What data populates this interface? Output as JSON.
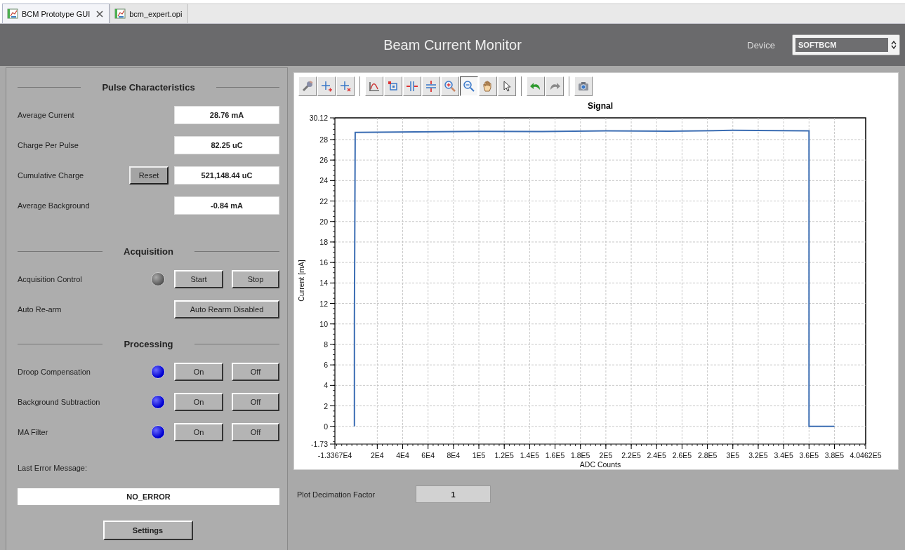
{
  "tabs": [
    {
      "label": "BCM Prototype GUI",
      "selected": true,
      "closable": true
    },
    {
      "label": "bcm_expert.opi",
      "selected": false,
      "closable": false
    }
  ],
  "header": {
    "title": "Beam Current Monitor",
    "device_label": "Device",
    "device": "SOFTBCM"
  },
  "sections": [
    {
      "title": "Pulse Characteristics",
      "rows": [
        {
          "kind": "readout",
          "label": "Average Current",
          "value": "28.76 mA"
        },
        {
          "kind": "readout",
          "label": "Charge Per Pulse",
          "value": "82.25 uC"
        },
        {
          "kind": "readout",
          "label": "Cumulative Charge",
          "button": "Reset",
          "value": "521,148.44 uC"
        },
        {
          "kind": "readout",
          "label": "Average Background",
          "value": "-0.84 mA"
        }
      ]
    },
    {
      "title": "Acquisition",
      "rows": [
        {
          "kind": "led-buttons",
          "label": "Acquisition Control",
          "on": false,
          "buttons": [
            "Start",
            "Stop"
          ]
        },
        {
          "kind": "button",
          "label": "Auto Re-arm",
          "button": "Auto Rearm Disabled"
        }
      ]
    },
    {
      "title": "Processing",
      "rows": [
        {
          "kind": "led-buttons",
          "label": "Droop Compensation",
          "on": true,
          "buttons": [
            "On",
            "Off"
          ]
        },
        {
          "kind": "led-buttons",
          "label": "Background Subtraction",
          "on": true,
          "buttons": [
            "On",
            "Off"
          ]
        },
        {
          "kind": "led-buttons",
          "label": "MA Filter",
          "on": true,
          "buttons": [
            "On",
            "Off"
          ]
        }
      ]
    }
  ],
  "last_error": {
    "label": "Last Error Message:",
    "value": "NO_ERROR"
  },
  "settings_button": "Settings",
  "plot": {
    "toolbar": [
      [
        {
          "kind": "settings",
          "selected": false
        },
        {
          "kind": "add-marker",
          "selected": false
        },
        {
          "kind": "remove-marker",
          "selected": false
        }
      ],
      [
        {
          "kind": "autoscale",
          "selected": false
        },
        {
          "kind": "box-zoom",
          "selected": false
        },
        {
          "kind": "horizontal-zoom",
          "selected": false
        },
        {
          "kind": "vertical-zoom",
          "selected": false
        },
        {
          "kind": "zoom-in",
          "selected": false
        },
        {
          "kind": "zoom-out",
          "selected": true
        },
        {
          "kind": "pan",
          "selected": false
        },
        {
          "kind": "pointer",
          "selected": false
        }
      ],
      [
        {
          "kind": "undo",
          "selected": false
        },
        {
          "kind": "redo",
          "selected": false
        }
      ],
      [
        {
          "kind": "snapshot",
          "selected": false
        }
      ]
    ],
    "chart_data": {
      "type": "line",
      "title": "Signal",
      "xlabel": "ADC Counts",
      "ylabel": "Current [mA]",
      "x": [
        2000,
        2000,
        2600,
        50000,
        100000,
        150000,
        200000,
        250000,
        300000,
        359000,
        360000,
        360000,
        380000
      ],
      "grid": true,
      "series": [
        {
          "color": "#3b6db3",
          "values": [
            0,
            10.5,
            28.7,
            28.75,
            28.8,
            28.78,
            28.85,
            28.82,
            28.9,
            28.86,
            28.86,
            0,
            0
          ]
        }
      ],
      "xlim": [
        -13367,
        404620
      ],
      "ylim": [
        -1.73,
        30.12
      ],
      "xticks": [
        {
          "value": -13367,
          "label": "-1.3367E4"
        },
        {
          "value": 20000,
          "label": "2E4"
        },
        {
          "value": 40000,
          "label": "4E4"
        },
        {
          "value": 60000,
          "label": "6E4"
        },
        {
          "value": 80000,
          "label": "8E4"
        },
        {
          "value": 100000,
          "label": "1E5"
        },
        {
          "value": 120000,
          "label": "1.2E5"
        },
        {
          "value": 140000,
          "label": "1.4E5"
        },
        {
          "value": 160000,
          "label": "1.6E5"
        },
        {
          "value": 180000,
          "label": "1.8E5"
        },
        {
          "value": 200000,
          "label": "2E5"
        },
        {
          "value": 220000,
          "label": "2.2E5"
        },
        {
          "value": 240000,
          "label": "2.4E5"
        },
        {
          "value": 260000,
          "label": "2.6E5"
        },
        {
          "value": 280000,
          "label": "2.8E5"
        },
        {
          "value": 300000,
          "label": "3E5"
        },
        {
          "value": 320000,
          "label": "3.2E5"
        },
        {
          "value": 340000,
          "label": "3.4E5"
        },
        {
          "value": 360000,
          "label": "3.6E5"
        },
        {
          "value": 380000,
          "label": "3.8E5"
        },
        {
          "value": 404620,
          "label": "4.0462E5"
        }
      ],
      "yticks": [
        -1.73,
        0,
        2,
        4,
        6,
        8,
        10,
        12,
        14,
        16,
        18,
        20,
        22,
        24,
        26,
        28,
        30.12
      ]
    }
  },
  "decimation": {
    "label": "Plot Decimation Factor",
    "value": "1"
  }
}
